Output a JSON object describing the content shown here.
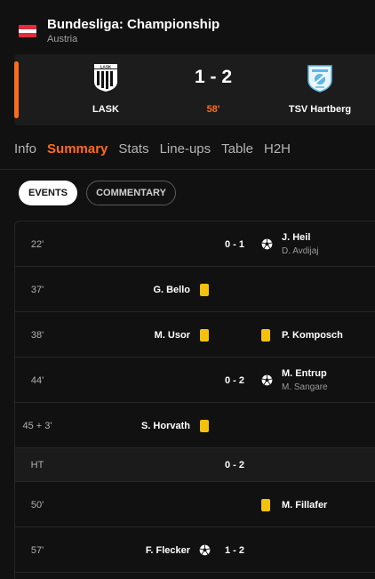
{
  "header": {
    "competition": "Bundesliga: Championship",
    "country": "Austria",
    "flag_colors": [
      "#e32b3c",
      "#ffffff",
      "#e32b3c"
    ]
  },
  "match": {
    "home_team": "LASK",
    "away_team": "TSV Hartberg",
    "score": "1 - 2",
    "minute": "58'",
    "home_logo": "lask-crest-icon",
    "away_logo": "tsv-hartberg-crest-icon"
  },
  "tabs": [
    {
      "label": "Info",
      "active": false
    },
    {
      "label": "Summary",
      "active": true
    },
    {
      "label": "Stats",
      "active": false
    },
    {
      "label": "Line-ups",
      "active": false
    },
    {
      "label": "Table",
      "active": false
    },
    {
      "label": "H2H",
      "active": false
    }
  ],
  "filters": {
    "events_label": "EVENTS",
    "commentary_label": "COMMENTARY",
    "selected": "EVENTS"
  },
  "events": [
    {
      "minute": "22'",
      "type": "goal",
      "side": "away",
      "score": "0 - 1",
      "player": "J. Heil",
      "assist": "D. Avdijaj"
    },
    {
      "minute": "37'",
      "type": "yellow-card",
      "side": "home",
      "player": "G. Bello"
    },
    {
      "minute": "38'",
      "type": "yellow-card",
      "side": "both",
      "home_player": "M. Usor",
      "away_player": "P. Komposch"
    },
    {
      "minute": "44'",
      "type": "goal",
      "side": "away",
      "score": "0 - 2",
      "player": "M. Entrup",
      "assist": "M. Sangare"
    },
    {
      "minute": "45 + 3'",
      "type": "yellow-card",
      "side": "home",
      "player": "S. Horvath"
    },
    {
      "minute": "HT",
      "type": "half-time",
      "score": "0 - 2"
    },
    {
      "minute": "50'",
      "type": "yellow-card",
      "side": "away",
      "player": "M. Fillafer"
    },
    {
      "minute": "57'",
      "type": "goal",
      "side": "home",
      "score": "1 - 2",
      "player": "F. Flecker"
    }
  ],
  "colors": {
    "accent": "#ff6b1a",
    "yellow_card": "#f4c20d",
    "background": "#111111"
  }
}
